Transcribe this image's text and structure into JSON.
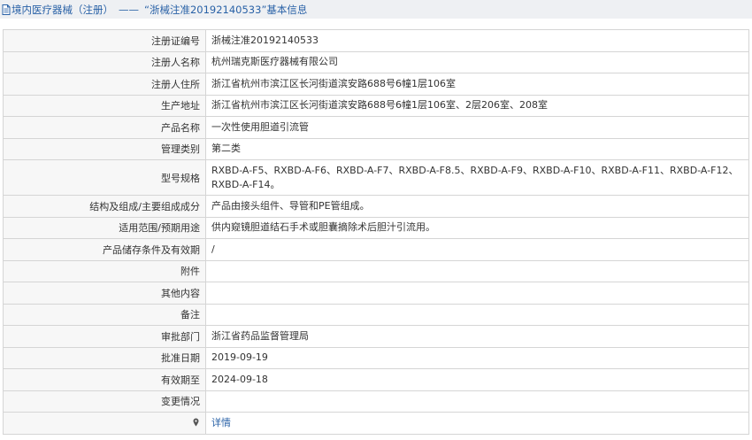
{
  "header": {
    "section": "境内医疗器械（注册）",
    "separator": "——",
    "title": "“浙械注准20192140533”基本信息"
  },
  "rows": [
    {
      "label": "注册证编号",
      "value": "浙械注准20192140533"
    },
    {
      "label": "注册人名称",
      "value": "杭州瑞克斯医疗器械有限公司"
    },
    {
      "label": "注册人住所",
      "value": "浙江省杭州市滨江区长河街道滨安路688号6幢1层106室"
    },
    {
      "label": "生产地址",
      "value": "浙江省杭州市滨江区长河街道滨安路688号6幢1层106室、2层206室、208室"
    },
    {
      "label": "产品名称",
      "value": "一次性使用胆道引流管"
    },
    {
      "label": "管理类别",
      "value": "第二类"
    },
    {
      "label": "型号规格",
      "value": "RXBD-A-F5、RXBD-A-F6、RXBD-A-F7、RXBD-A-F8.5、RXBD-A-F9、RXBD-A-F10、RXBD-A-F11、RXBD-A-F12、RXBD-A-F14。"
    },
    {
      "label": "结构及组成/主要组成成分",
      "value": "产品由接头组件、导管和PE管组成。"
    },
    {
      "label": "适用范围/预期用途",
      "value": "供内窥镜胆道结石手术或胆囊摘除术后胆汁引流用。"
    },
    {
      "label": "产品储存条件及有效期",
      "value": "/"
    },
    {
      "label": "附件",
      "value": ""
    },
    {
      "label": "其他内容",
      "value": ""
    },
    {
      "label": "备注",
      "value": ""
    },
    {
      "label": "审批部门",
      "value": "浙江省药品监督管理局"
    },
    {
      "label": "批准日期",
      "value": "2019-09-19"
    },
    {
      "label": "有效期至",
      "value": "2024-09-18"
    },
    {
      "label": "变更情况",
      "value": ""
    }
  ],
  "last_row": {
    "label": "",
    "link_text": "详情",
    "icon": "pin-icon"
  },
  "colors": {
    "link": "#2a62a7",
    "header_bg": "#eef0f3",
    "label_bg": "#f7f7f7",
    "border": "#d5d5d5"
  }
}
